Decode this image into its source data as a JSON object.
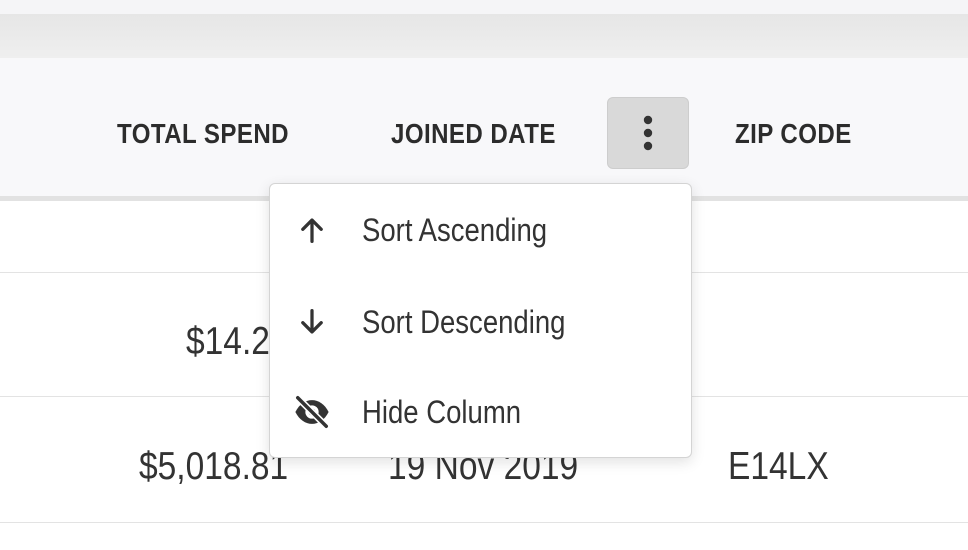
{
  "table": {
    "headers": {
      "total_spend": "TOTAL SPEND",
      "joined_date": "JOINED DATE",
      "zip_code": "ZIP CODE"
    },
    "rows": [
      {
        "total_spend": "",
        "joined_date": "",
        "zip_code": ""
      },
      {
        "total_spend": "$14.2",
        "joined_date": "",
        "zip_code": ""
      },
      {
        "total_spend": "$5,018.81",
        "joined_date": "19 Nov 2019",
        "zip_code": "E14LX"
      }
    ]
  },
  "column_menu": {
    "button_icon": "more-vert-icon",
    "items": [
      {
        "label": "Sort Ascending",
        "icon": "arrow-up-icon"
      },
      {
        "label": "Sort Descending",
        "icon": "arrow-down-icon"
      },
      {
        "label": "Hide Column",
        "icon": "eye-off-icon"
      }
    ]
  },
  "colors": {
    "header_bg": "#f8f8fa",
    "menu_button_bg": "#d9d9d9",
    "text": "#333333",
    "header_text": "#2c2c2c"
  }
}
